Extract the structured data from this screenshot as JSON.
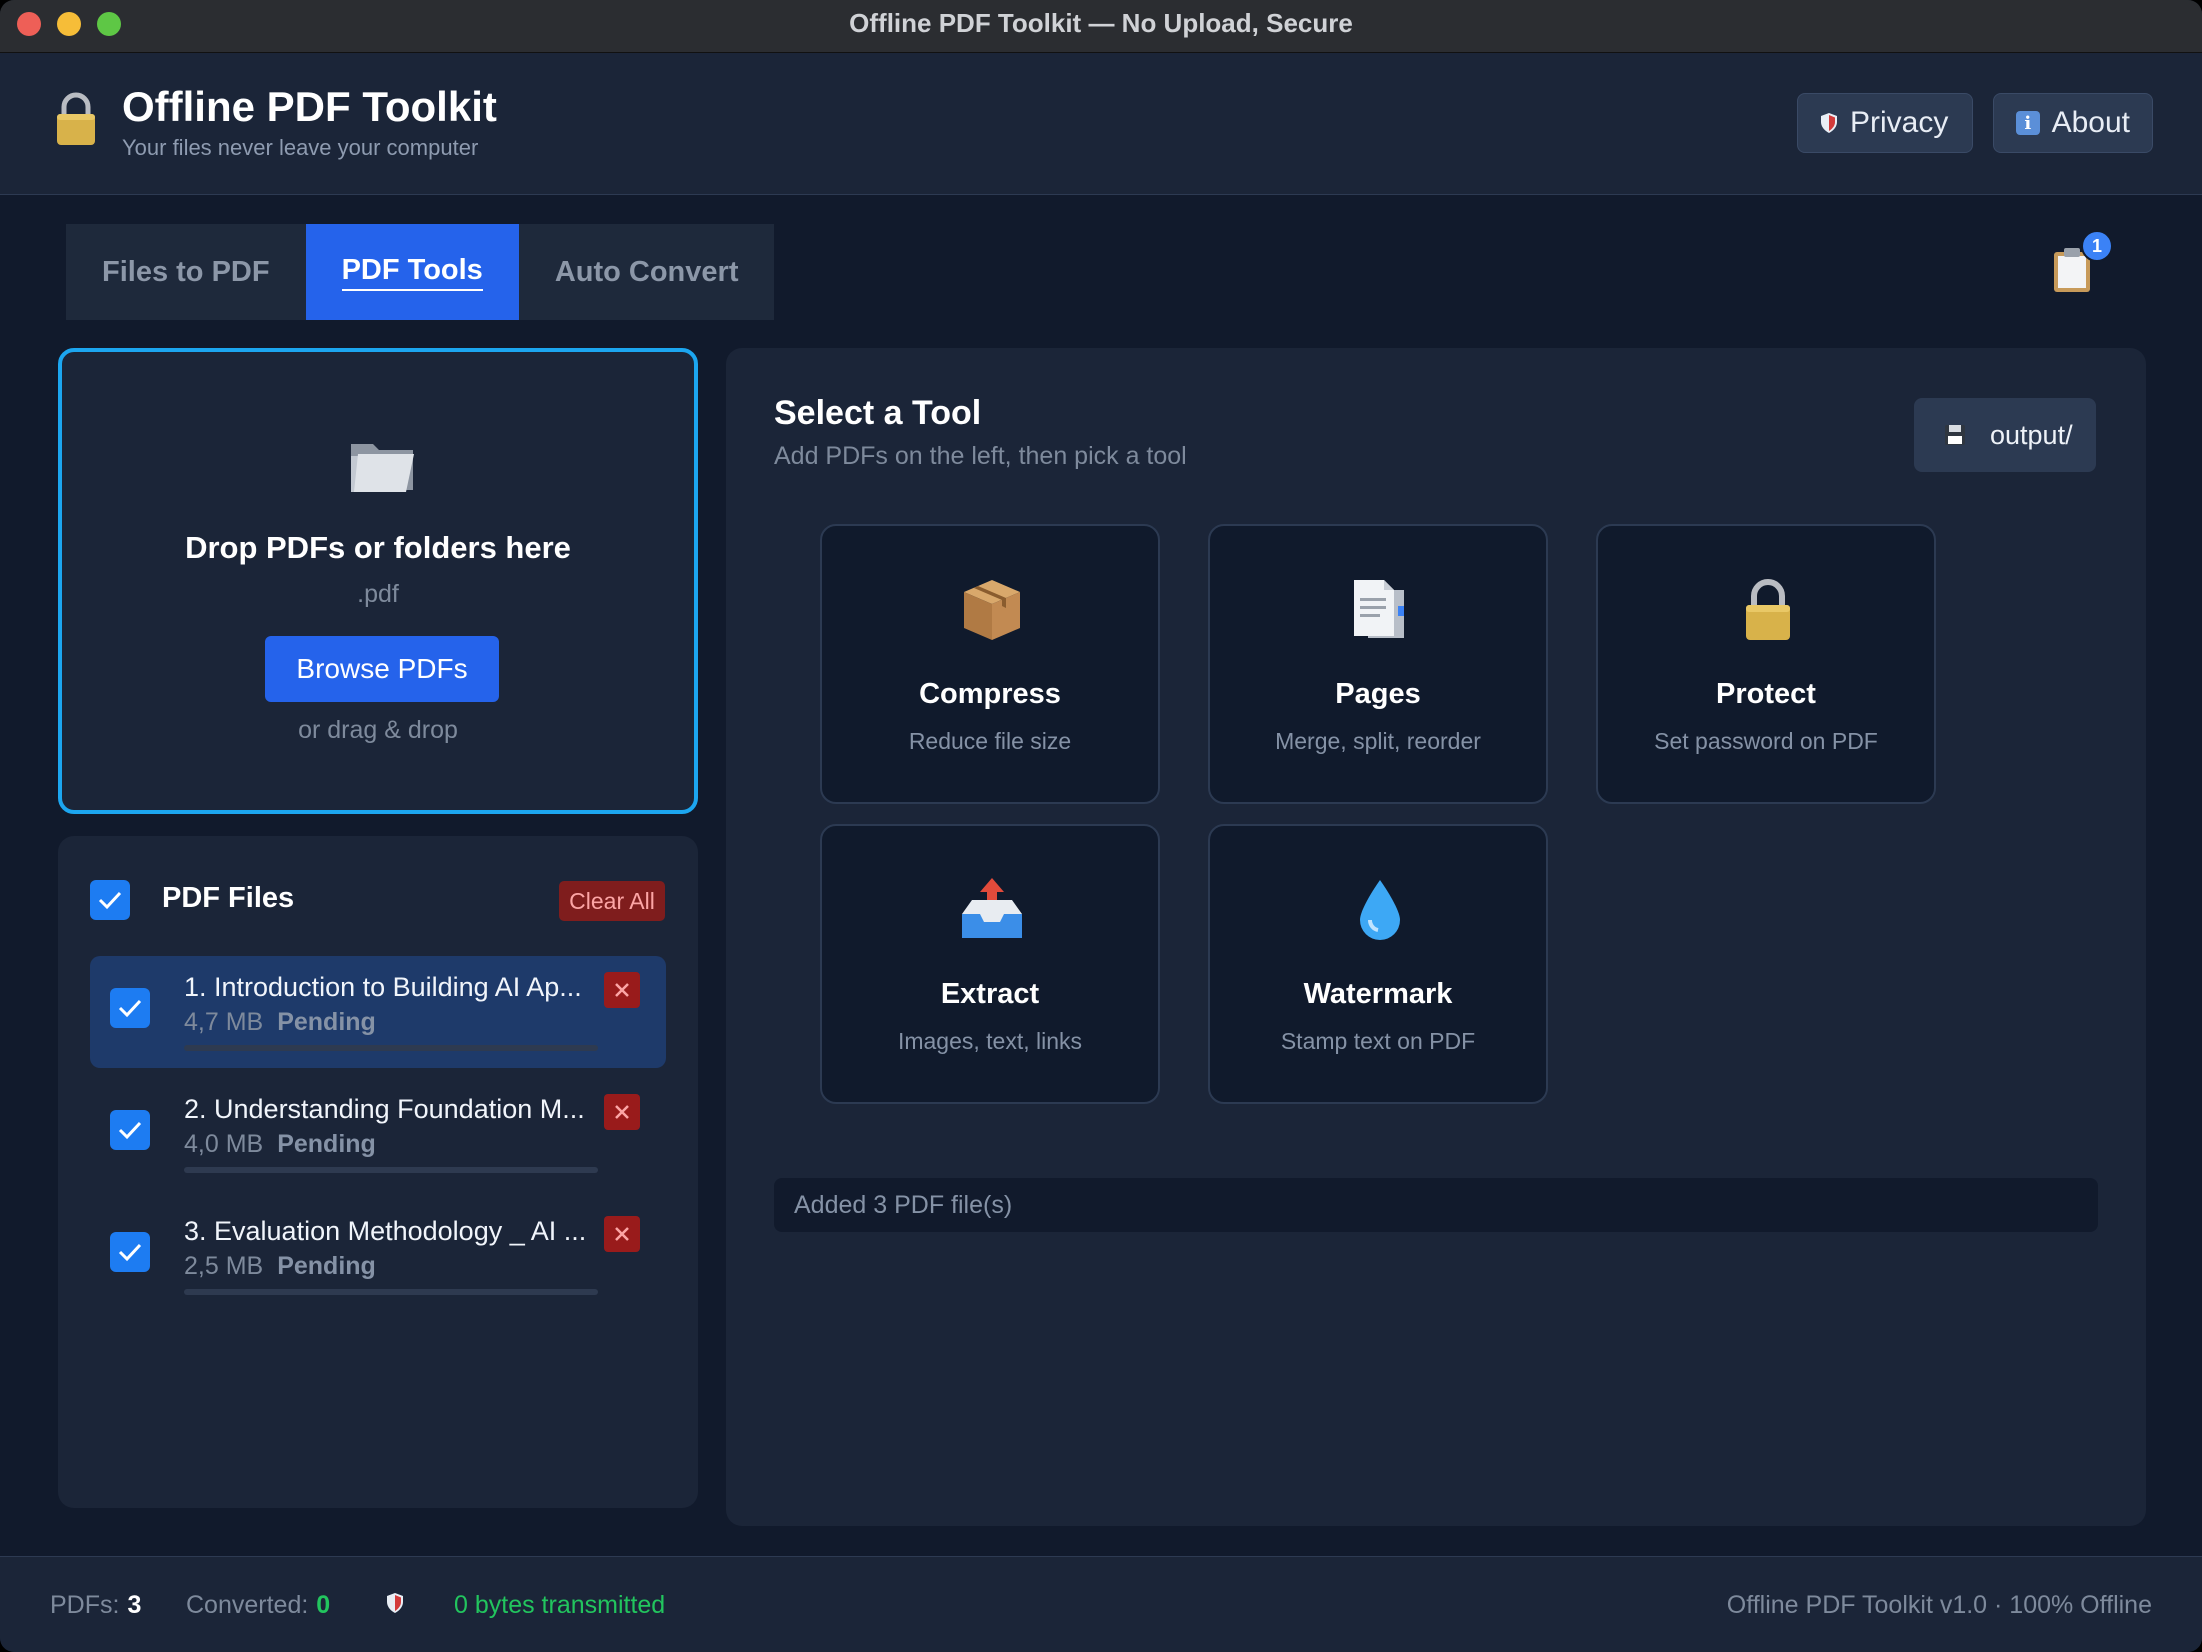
{
  "window": {
    "title": "Offline PDF Toolkit — No Upload, Secure"
  },
  "header": {
    "app_title": "Offline PDF Toolkit",
    "subtitle": "Your files never leave your computer",
    "buttons": {
      "privacy": "Privacy",
      "about": "About"
    },
    "icons": {
      "logo": "lock-icon",
      "privacy": "shield-icon",
      "about": "info-icon"
    }
  },
  "tabs": [
    {
      "label": "Files to PDF",
      "active": false
    },
    {
      "label": "PDF Tools",
      "active": true
    },
    {
      "label": "Auto Convert",
      "active": false
    }
  ],
  "clipboard": {
    "icon": "clipboard-icon",
    "badge": "1"
  },
  "dropzone": {
    "title": "Drop PDFs or folders here",
    "extension": ".pdf",
    "browse_label": "Browse PDFs",
    "hint": "or drag & drop",
    "icon": "folder-icon"
  },
  "files": {
    "title": "PDF Files",
    "select_all_checked": true,
    "clear_label": "Clear All",
    "items": [
      {
        "name": "1. Introduction to Building AI Ap...",
        "size": "4,7 MB",
        "status": "Pending",
        "checked": true,
        "selected": true,
        "progress": 0
      },
      {
        "name": "2. Understanding Foundation M...",
        "size": "4,0 MB",
        "status": "Pending",
        "checked": true,
        "selected": false,
        "progress": 0
      },
      {
        "name": "3. Evaluation Methodology _ AI ...",
        "size": "2,5 MB",
        "status": "Pending",
        "checked": true,
        "selected": false,
        "progress": 0
      }
    ]
  },
  "tools": {
    "title": "Select a Tool",
    "subtitle": "Add PDFs on the left, then pick a tool",
    "output_label": "output/",
    "output_icon": "floppy-disk-icon",
    "items": [
      {
        "name": "Compress",
        "desc": "Reduce file size",
        "icon": "package-icon"
      },
      {
        "name": "Pages",
        "desc": "Merge, split, reorder",
        "icon": "pages-icon"
      },
      {
        "name": "Protect",
        "desc": "Set password on PDF",
        "icon": "lock-icon"
      },
      {
        "name": "Extract",
        "desc": "Images, text, links",
        "icon": "outbox-tray-icon"
      },
      {
        "name": "Watermark",
        "desc": "Stamp text on PDF",
        "icon": "droplet-icon"
      }
    ],
    "log": "Added  3  PDF file(s)"
  },
  "footer": {
    "pdfs_label": "PDFs:",
    "pdfs_value": "3",
    "converted_label": "Converted:",
    "converted_value": "0",
    "secure_text": "0 bytes transmitted",
    "version": "Offline PDF Toolkit v1.0 · 100% Offline"
  },
  "colors": {
    "accent": "#2563eb",
    "dropzone_border": "#1ca6f0",
    "danger": "#991b1b",
    "success": "#22c55e",
    "background": "#111a2c",
    "panel": "#1b2538"
  }
}
